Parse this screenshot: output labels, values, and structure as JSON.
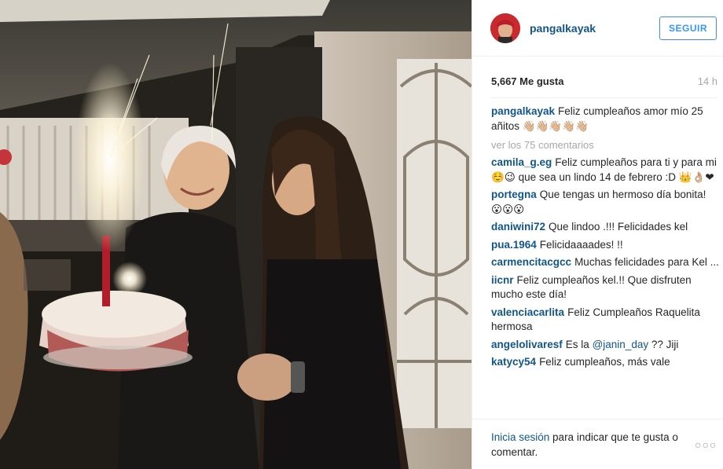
{
  "post": {
    "username": "pangalkayak",
    "follow_label": "SEGUIR",
    "likes": "5,667 Me gusta",
    "time_ago": "14 h",
    "caption": {
      "user": "pangalkayak",
      "text": "Feliz cumpleaños amor mío 25 añitos 👋🏼👋🏼👋🏼👋🏼👋🏼"
    },
    "view_all_comments": "ver los 75 comentarios",
    "comments": [
      {
        "user": "camila_g.eg",
        "text": "Feliz cumpleaños para ti y para mi ☺️😉 que sea un lindo 14 de febrero :D 👑👌🏼❤"
      },
      {
        "user": "portegna",
        "text": "Que tengas un hermoso día bonita! 😮😮😮"
      },
      {
        "user": "daniwini72",
        "text": "Que lindoo .!!! Felicidades kel"
      },
      {
        "user": "pua.1964",
        "text": "Felicidaaaades! !!"
      },
      {
        "user": "carmencitacgcc",
        "text": "Muchas felicidades para Kel ..."
      },
      {
        "user": "iicnr",
        "text": "Feliz cumpleaños kel.!! Que disfruten mucho este día!"
      },
      {
        "user": "valenciacarlita",
        "text": "Feliz Cumpleaños Raquelita hermosa"
      },
      {
        "user": "angelolivaresf",
        "text_before": "Es la",
        "mention": "@janin_day",
        "text_after": "?? Jiji"
      },
      {
        "user": "katycy54",
        "text": "Feliz cumpleaños, más vale"
      }
    ]
  },
  "footer": {
    "login_link": "Inicia sesión",
    "login_text": " para indicar que te gusta o comentar.",
    "more_icon": "ellipsis-icon",
    "more_label": "○○○"
  },
  "photo": {
    "description_icon": "birthday-photo"
  }
}
